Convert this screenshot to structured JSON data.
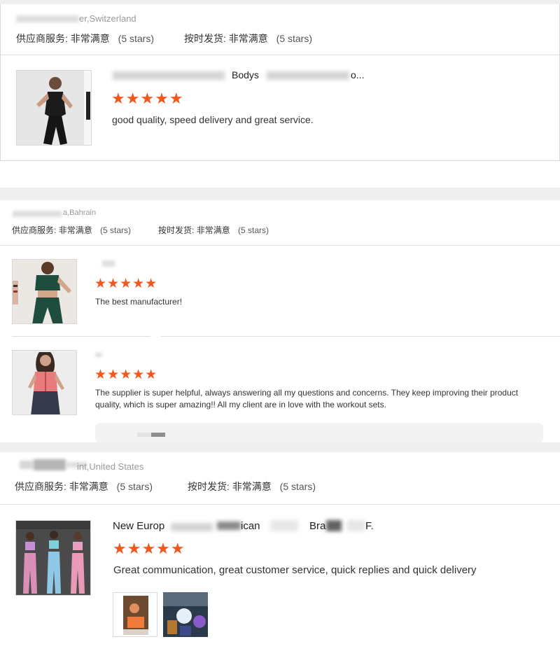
{
  "reviews": [
    {
      "location": "Mundo Se... er,Switzerland",
      "location_visible": "er,Switzerland",
      "service_label": "供应商服务:",
      "service_value": "非常满意",
      "service_stars": "(5 stars)",
      "delivery_label": "按时发货:",
      "delivery_value": "非常满意",
      "delivery_stars": "(5 stars)",
      "products": [
        {
          "title_fragments": [
            "Bodys",
            "o..."
          ],
          "rating_stars": "★★★★★",
          "review_text": "good quality, speed delivery and great service."
        }
      ]
    },
    {
      "location": "a,Bahrain",
      "location_visible": "a,Bahrain",
      "service_label": "供应商服务:",
      "service_value": "非常满意",
      "service_stars": "(5 stars)",
      "delivery_label": "按时发货:",
      "delivery_value": "非常满意",
      "delivery_stars": "(5 stars)",
      "products": [
        {
          "rating_stars": "★★★★★",
          "review_text": "The best manufacturer!"
        },
        {
          "rating_stars": "★★★★★",
          "review_text": "The supplier is super helpful, always answering all my questions and concerns. They keep improving their product quality, which is super amazing!! All my client are in love with the workout sets."
        }
      ]
    },
    {
      "location": "int,United States",
      "location_visible": "int,United States",
      "service_label": "供应商服务:",
      "service_value": "非常满意",
      "service_stars": "(5 stars)",
      "delivery_label": "按时发货:",
      "delivery_value": "非常满意",
      "delivery_stars": "(5 stars)",
      "products": [
        {
          "title_fragments": [
            "New Europ",
            "ican",
            "Bra",
            "F."
          ],
          "rating_stars": "★★★★★",
          "review_text": "Great communication, great customer service, quick replies and quick delivery"
        }
      ]
    }
  ],
  "colors": {
    "star": "#f2581e",
    "muted": "#9b9b9b",
    "strip": "#efefef"
  }
}
